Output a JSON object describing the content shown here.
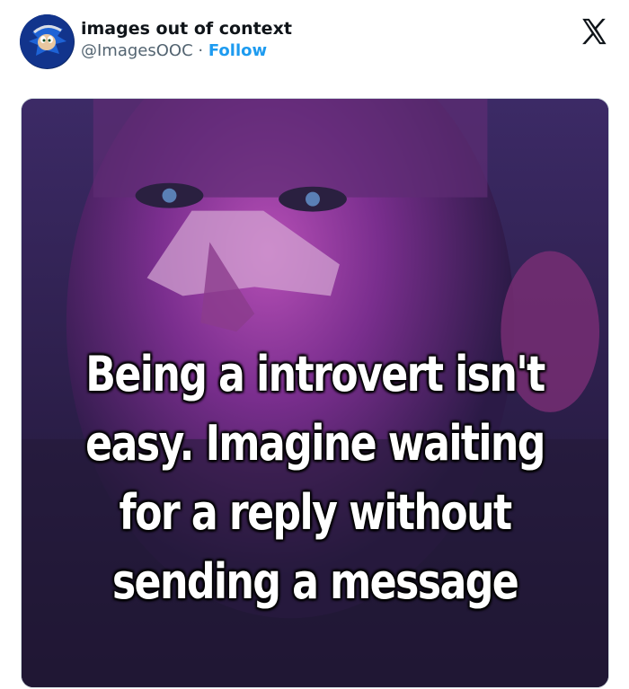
{
  "post": {
    "display_name": "images out of context",
    "handle": "@ImagesOOC",
    "separator": "·",
    "follow_label": "Follow",
    "avatar_icon": "sonic-avatar-icon",
    "platform_icon": "x-logo-icon"
  },
  "media": {
    "caption_lines": [
      "Being a introvert isn't",
      "easy. Imagine waiting",
      "for a reply without",
      "sending a message"
    ]
  },
  "colors": {
    "follow": "#1d9bf0",
    "name": "#0f1419",
    "handle": "#536471",
    "image_tint": "#6a2f8f"
  }
}
